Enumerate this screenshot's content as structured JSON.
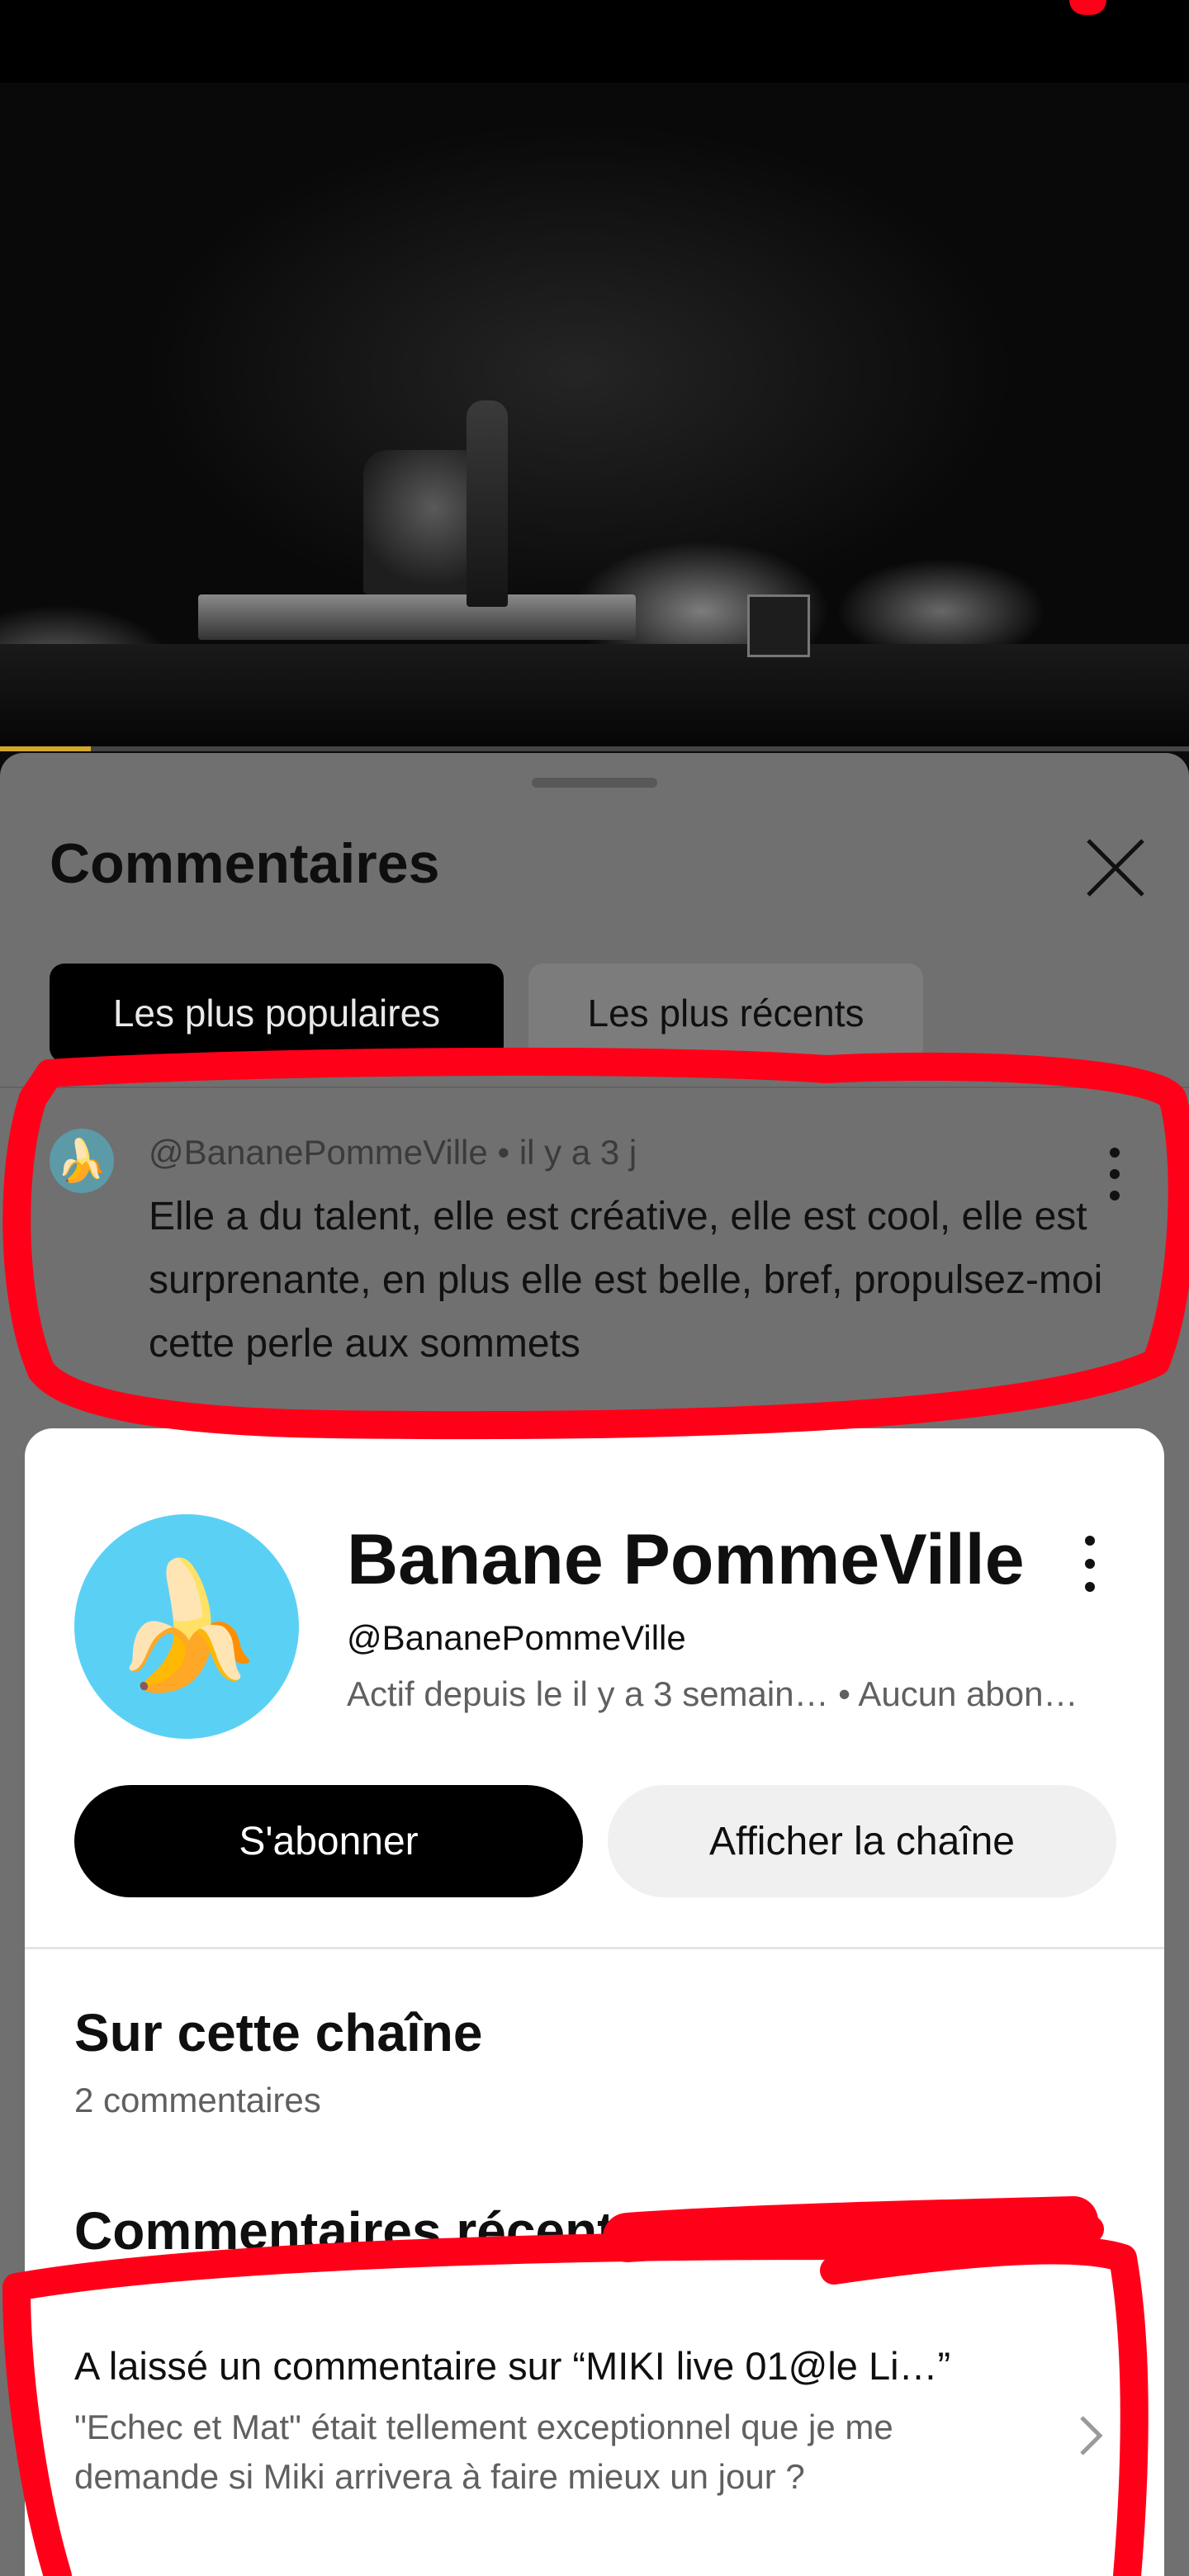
{
  "comments_sheet": {
    "title": "Commentaires",
    "sort_chips": [
      "Les plus populaires",
      "Les plus récents"
    ]
  },
  "top_comment": {
    "author": "@BananePommeVille",
    "time": "il y a 3 j",
    "text": "Elle a du talent, elle est créative, elle est cool, elle est surprenante, en plus elle est belle, bref, propulsez-moi cette perle aux sommets"
  },
  "channel_card": {
    "name": "Banane PommeVille",
    "handle": "@BananePommeVille",
    "info": "Actif depuis le il y a 3 semain… • Aucun abon…",
    "avatar_icon": "banana-icon",
    "avatar_bg": "#5bd0f5",
    "subscribe_label": "S'abonner",
    "view_channel_label": "Afficher la chaîne",
    "section_title": "Sur cette chaîne",
    "comment_count": "2 commentaires",
    "recent_title": "Commentaires récents",
    "recent_item": {
      "headline": "A laissé un commentaire sur “MIKI live 01@le Li…”",
      "snippet": "\"Echec et Mat\" était tellement exceptionnel que je me demande si Miki arrivera à faire mieux un jour ?"
    }
  },
  "annotation_color": "#ff0019"
}
